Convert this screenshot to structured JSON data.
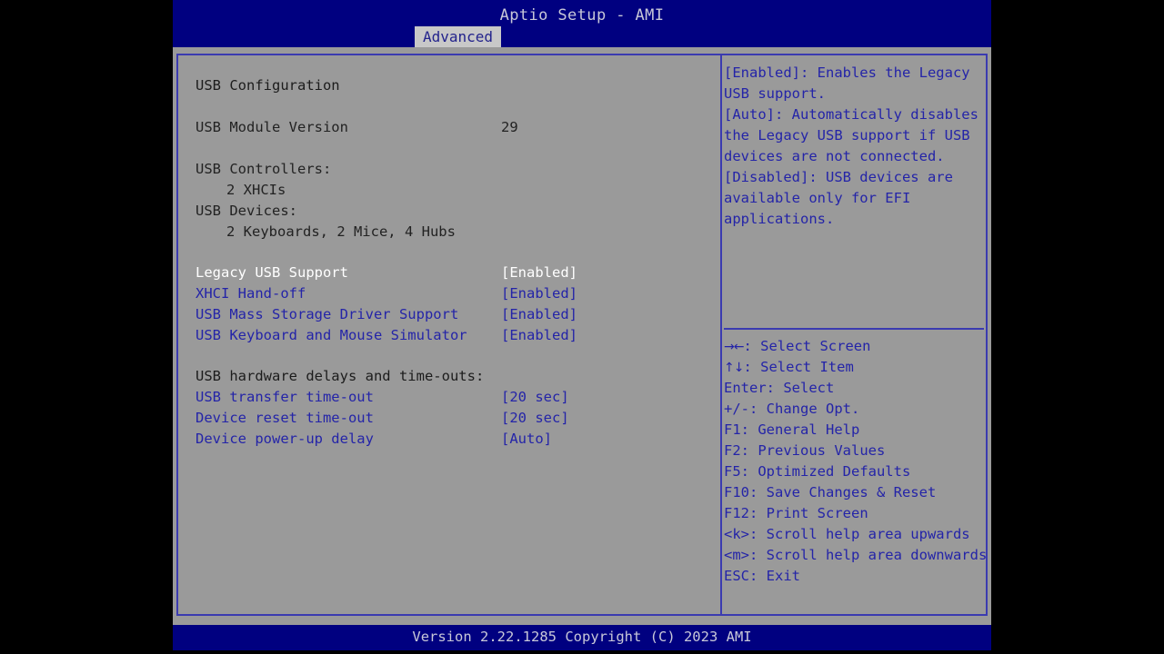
{
  "title_bar": {
    "title": "Aptio Setup - AMI",
    "tabs": [
      {
        "label": "Advanced",
        "active": true
      }
    ]
  },
  "settings_panel": {
    "section_title": "USB Configuration",
    "info_rows": [
      {
        "label": "USB Module Version",
        "value": "29"
      }
    ],
    "controllers": {
      "label": "USB Controllers:",
      "detail": "2 XHCIs"
    },
    "devices": {
      "label": "USB Devices:",
      "detail": "2 Keyboards, 2 Mice, 4 Hubs"
    },
    "options": [
      {
        "label": "Legacy USB Support",
        "value": "[Enabled]",
        "selected": true
      },
      {
        "label": "XHCI Hand-off",
        "value": "[Enabled]",
        "selected": false
      },
      {
        "label": "USB Mass Storage Driver Support",
        "value": "[Enabled]",
        "selected": false
      },
      {
        "label": "USB Keyboard and Mouse Simulator",
        "value": "[Enabled]",
        "selected": false
      }
    ],
    "delays_heading": "USB hardware delays and time-outs:",
    "delay_options": [
      {
        "label": "USB transfer time-out",
        "value": "[20 sec]",
        "selected": false
      },
      {
        "label": "Device reset time-out",
        "value": "[20 sec]",
        "selected": false
      },
      {
        "label": "Device power-up delay",
        "value": "[Auto]",
        "selected": false
      }
    ]
  },
  "help_panel": {
    "help_text": "[Enabled]: Enables the Legacy USB support.\n[Auto]: Automatically disables the Legacy USB support if USB devices are not connected.\n[Disabled]: USB devices are available only for EFI applications.",
    "key_legend": [
      {
        "key": "→←",
        "desc": ": Select Screen",
        "glyph": true
      },
      {
        "key": "↑↓",
        "desc": ": Select Item",
        "glyph": true
      },
      {
        "key": "Enter",
        "desc": ": Select",
        "glyph": false
      },
      {
        "key": "+/-",
        "desc": ": Change Opt.",
        "glyph": false
      },
      {
        "key": "F1",
        "desc": ": General Help",
        "glyph": false
      },
      {
        "key": "F2",
        "desc": ": Previous Values",
        "glyph": false
      },
      {
        "key": "F5",
        "desc": ": Optimized Defaults",
        "glyph": false
      },
      {
        "key": "F10",
        "desc": ": Save Changes & Reset",
        "glyph": false
      },
      {
        "key": "F12",
        "desc": ": Print Screen",
        "glyph": false
      },
      {
        "key": "<k>",
        "desc": ": Scroll help area upwards",
        "glyph": false
      },
      {
        "key": "<m>",
        "desc": ": Scroll help area downwards",
        "glyph": false
      },
      {
        "key": "ESC",
        "desc": ": Exit",
        "glyph": false
      }
    ]
  },
  "footer": {
    "version_text": "Version 2.22.1285 Copyright (C) 2023 AMI"
  },
  "colors": {
    "background_gray": "#9a9a9a",
    "title_blue": "#000080",
    "item_blue": "#2424a8",
    "selected_white": "#ffffff",
    "border_blue": "#3b3bb0",
    "tab_gray": "#c8c8c8"
  }
}
